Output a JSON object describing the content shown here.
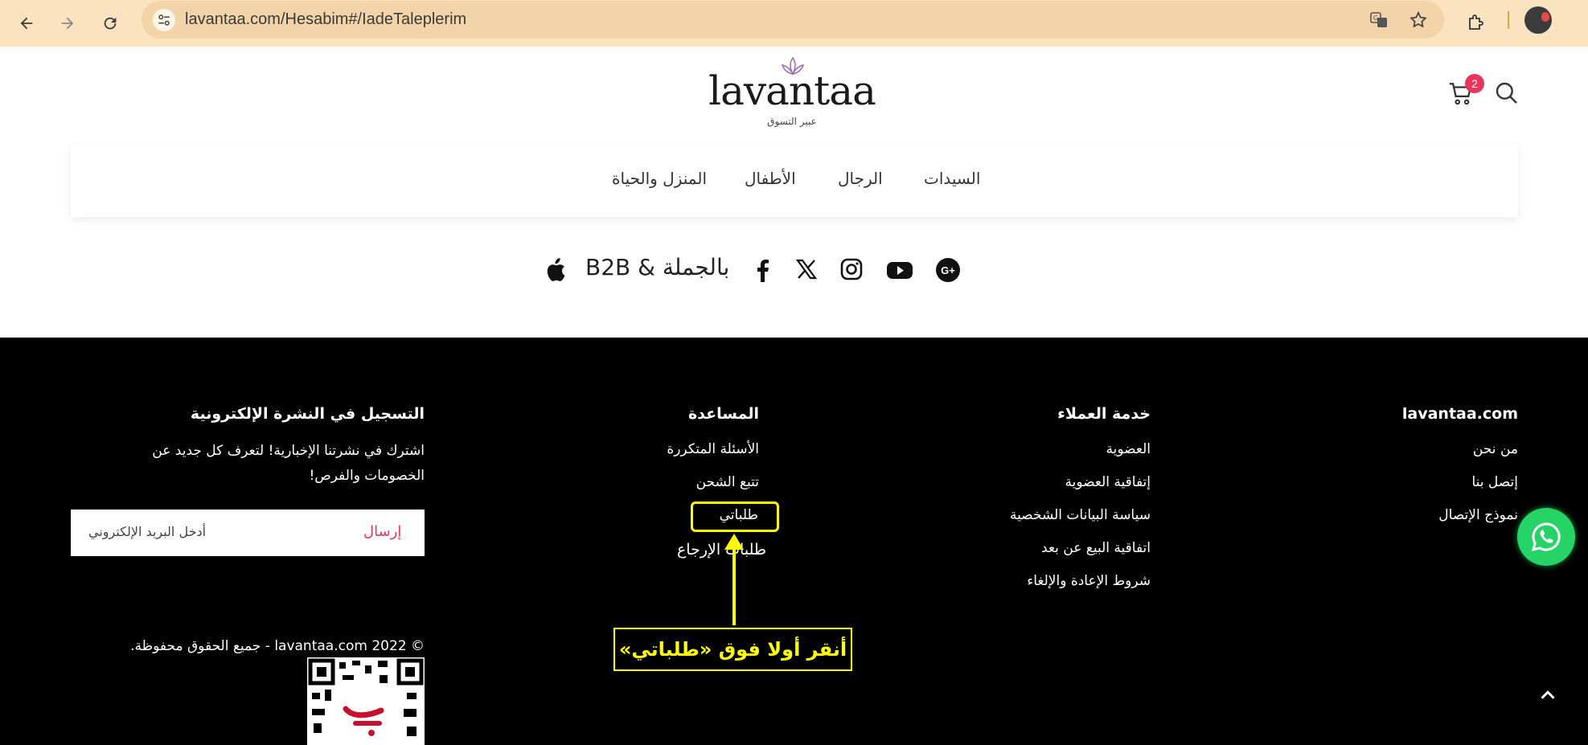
{
  "browser": {
    "url": "lavantaa.com/Hesabim#/IadeTaleplerim",
    "colors": {
      "chrome_bg": "#fbe3bf",
      "omnibox_bg": "#f3d4a8"
    }
  },
  "header": {
    "logo_text": "lavantaa",
    "logo_subtitle": "عبير التسوق",
    "cart_count": "2"
  },
  "menu": {
    "items": [
      "السيدات",
      "الرجال",
      "الأطفال",
      "المنزل والحياة"
    ]
  },
  "social": {
    "b2b_label": "بالجملة & B2B"
  },
  "footer": {
    "col1": {
      "title": "lavantaa.com",
      "links": [
        "من نحن",
        "إتصل بنا",
        "نموذج الإتصال"
      ]
    },
    "col2": {
      "title": "خدمة العملاء",
      "links": [
        "العضوية",
        "إتفاقية العضوية",
        "سياسة البيانات الشخصية",
        "اتفاقية البيع عن بعد",
        "شروط الإعادة والإلغاء"
      ]
    },
    "col3": {
      "title": "المساعدة",
      "links": [
        "الأسئلة المتكررة",
        "تتبع الشحن",
        "طلباتي",
        "طلبات الإرجاع"
      ]
    },
    "newsletter": {
      "title": "التسجيل في النشرة الإلكترونية",
      "description": "اشترك في نشرتنا الإخبارية! لتعرف كل جديد عن الخصومات والفرص!",
      "placeholder": "أدخل البريد الإلكتروني",
      "send_label": "إرسال"
    },
    "copyright": "© 2022 lavantaa.com - جميع الحقوق محفوظة."
  },
  "annotation": {
    "callout_text": "أنقر أولا فوق «طلباتي»",
    "color": "#ffff00"
  },
  "colors": {
    "accent": "#e8355b",
    "whatsapp": "#25d366"
  }
}
